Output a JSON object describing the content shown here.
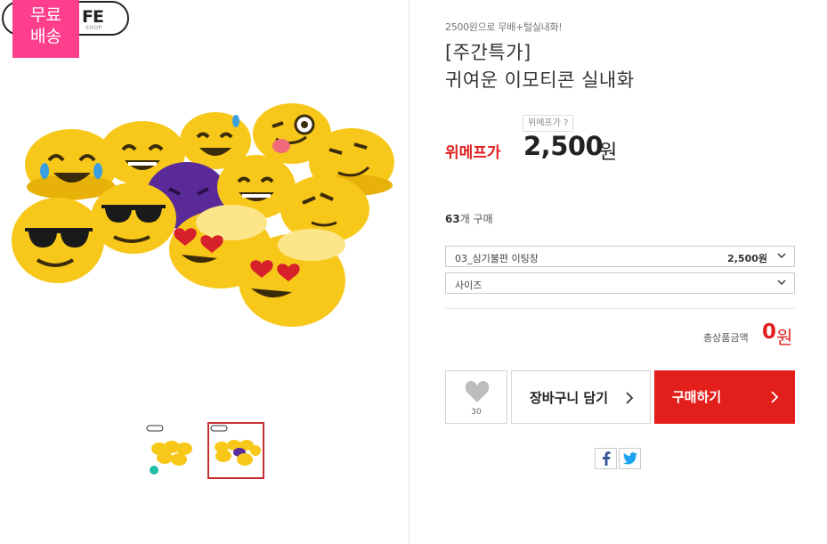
{
  "badge": {
    "line1": "무료",
    "line2": "배송"
  },
  "logo": {
    "text": "FE",
    "sub": "SHOP"
  },
  "product": {
    "promo": "2500원으로 무배+털실내화!",
    "title_line1": "[주간특가]",
    "title_line2": "귀여운 이모티콘 실내화",
    "price_info_label": "위메프가 ?",
    "price_label": "위메프가",
    "price": "2,500",
    "price_unit": "원",
    "buy_count": "63",
    "buy_count_suffix": "개 구매"
  },
  "options": [
    {
      "label": "03_심기불편 이팅장",
      "price": "2,500원"
    },
    {
      "label": "사이즈",
      "price": ""
    }
  ],
  "total": {
    "label": "총상품금액",
    "value": "0",
    "unit": "원"
  },
  "actions": {
    "like_count": "30",
    "cart_label": "장바구니 담기",
    "buy_label": "구매하기"
  },
  "share": {
    "facebook_icon": "facebook-icon",
    "twitter_icon": "twitter-icon"
  },
  "colors": {
    "accent_red": "#e31f1c",
    "badge_pink": "#ff3f8d"
  }
}
